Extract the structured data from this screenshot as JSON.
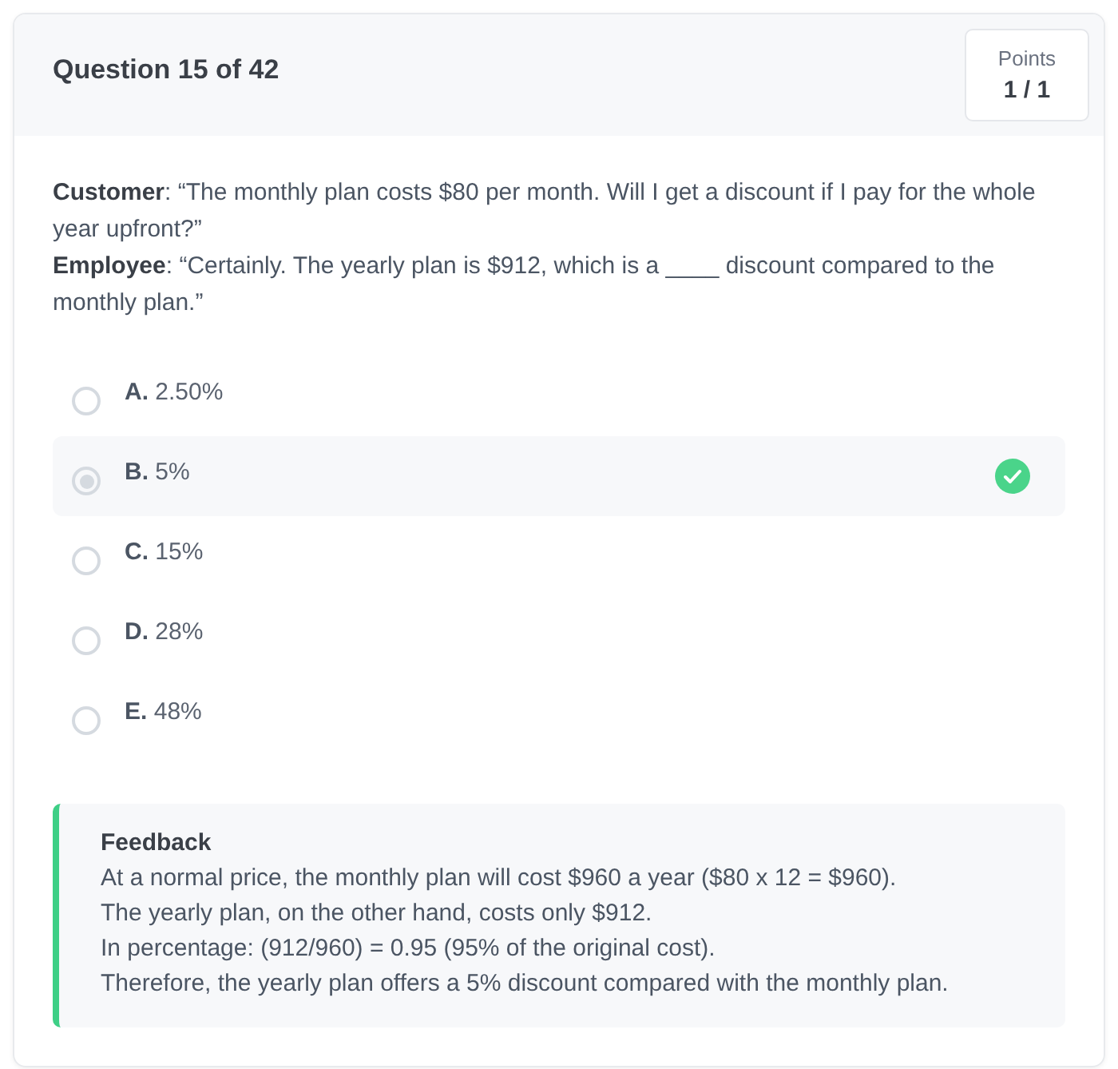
{
  "question": {
    "title": "Question 15 of 42",
    "points_label": "Points",
    "points": "1 / 1"
  },
  "prompt": [
    "**Customer**: “The monthly plan costs $80 per month. Will I get a discount if I pay for the whole year upfront?”",
    "**Employee**: “Certainly. The yearly plan is $912, which is a ____ discount compared to the monthly plan.”"
  ],
  "options": [
    {
      "letter": "A.",
      "text": "2.50%",
      "selected": false,
      "correct": false
    },
    {
      "letter": "B.",
      "text": "5%",
      "selected": true,
      "correct": true
    },
    {
      "letter": "C.",
      "text": "15%",
      "selected": false,
      "correct": false
    },
    {
      "letter": "D.",
      "text": "28%",
      "selected": false,
      "correct": false
    },
    {
      "letter": "E.",
      "text": "48%",
      "selected": false,
      "correct": false
    }
  ],
  "feedback": {
    "title": "Feedback",
    "lines": [
      "At a normal price, the monthly plan will cost $960 a year ($80 x 12 = $960).",
      "The yearly plan, on the other hand, costs only $912.",
      "In percentage: (912/960) = 0.95 (95% of the original cost).",
      "Therefore, the yearly plan offers a 5% discount compared with the monthly plan."
    ]
  }
}
